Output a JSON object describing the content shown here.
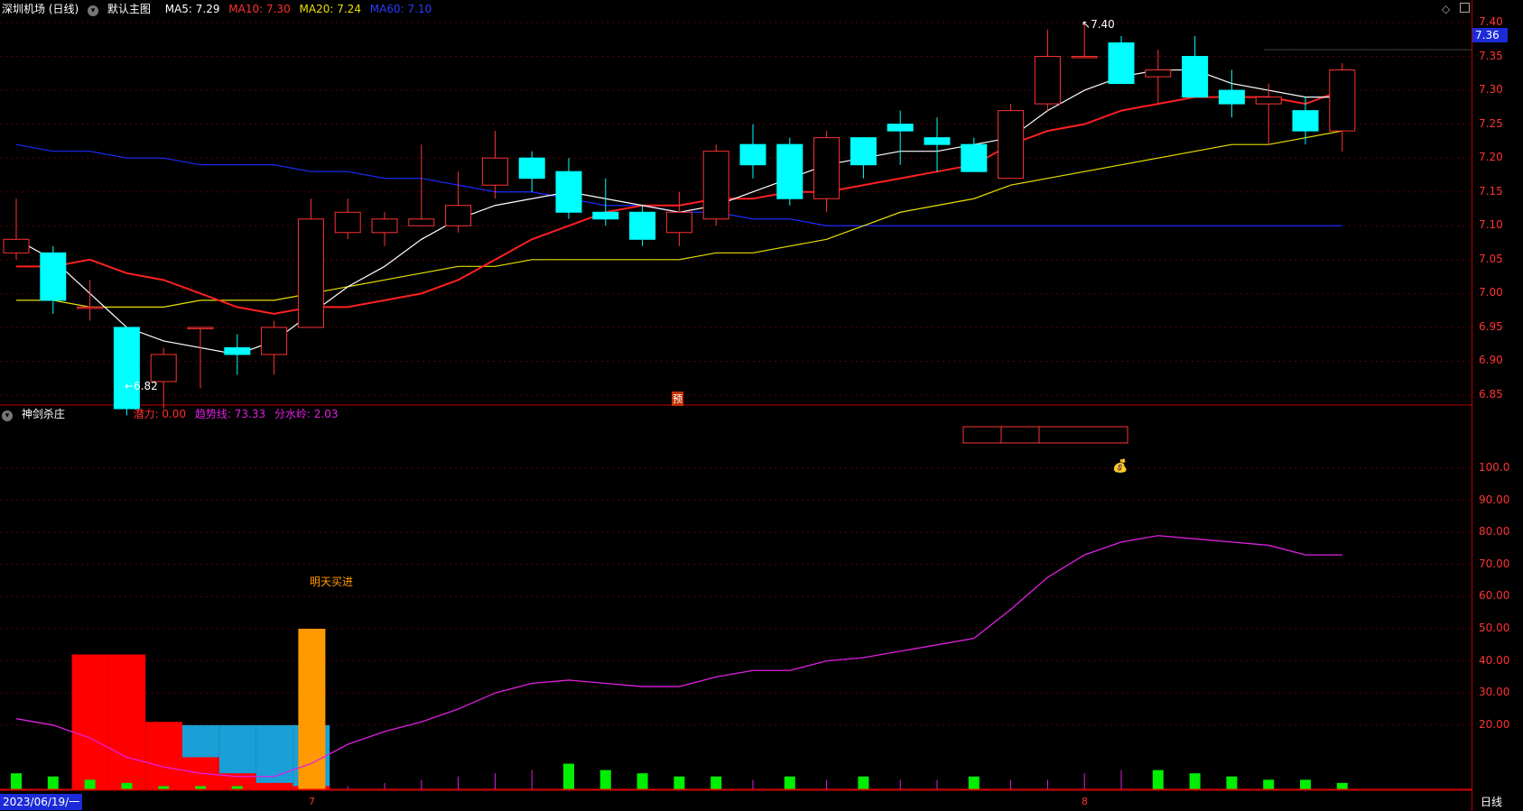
{
  "main_panel": {
    "stock_name": "深圳机场 (日线)",
    "template_label": "默认主图",
    "ma5": "MA5: 7.29",
    "ma10": "MA10: 7.30",
    "ma20": "MA20: 7.24",
    "ma60": "MA60: 7.10",
    "current_price": "7.36",
    "high_marker": "7.40",
    "low_marker": "6.82",
    "pre_marker": "预",
    "y_ticks": [
      "7.40",
      "7.35",
      "7.30",
      "7.25",
      "7.20",
      "7.15",
      "7.10",
      "7.05",
      "7.00",
      "6.95",
      "6.90",
      "6.85"
    ]
  },
  "sub_panel": {
    "indicator_name": "神剑杀庄",
    "latent_power": "潜力: 0.00",
    "trend_line": "趋势线: 73.33",
    "watershed": "分水岭: 2.03",
    "buy_signal": "明天买进",
    "y_ticks": [
      "100.0",
      "90.00",
      "80.00",
      "70.00",
      "60.00",
      "50.00",
      "40.00",
      "30.00",
      "20.00"
    ]
  },
  "bottom_bar": {
    "date_label": "2023/06/19/一",
    "month_7": "7",
    "month_8": "8",
    "period_label": "日线"
  },
  "colors": {
    "up": "#ff3333",
    "down": "#00ffff",
    "ma5": "#ffffff",
    "ma10": "#ff2020",
    "ma20": "#e8e000",
    "ma60": "#1a2cff",
    "trend": "#e020e0",
    "accent_orange": "#ff9900"
  },
  "chart_data": {
    "type": "candlestick",
    "candles": [
      {
        "o": 7.06,
        "h": 7.14,
        "l": 7.05,
        "c": 7.08
      },
      {
        "o": 7.06,
        "h": 7.07,
        "l": 6.97,
        "c": 6.99
      },
      {
        "o": 6.98,
        "h": 7.02,
        "l": 6.96,
        "c": 6.98
      },
      {
        "o": 6.95,
        "h": 6.95,
        "l": 6.82,
        "c": 6.83
      },
      {
        "o": 6.87,
        "h": 6.92,
        "l": 6.83,
        "c": 6.91
      },
      {
        "o": 6.95,
        "h": 6.95,
        "l": 6.86,
        "c": 6.95
      },
      {
        "o": 6.92,
        "h": 6.94,
        "l": 6.88,
        "c": 6.91
      },
      {
        "o": 6.91,
        "h": 6.96,
        "l": 6.88,
        "c": 6.95
      },
      {
        "o": 6.95,
        "h": 7.14,
        "l": 6.95,
        "c": 7.11
      },
      {
        "o": 7.09,
        "h": 7.14,
        "l": 7.08,
        "c": 7.12
      },
      {
        "o": 7.09,
        "h": 7.12,
        "l": 7.07,
        "c": 7.11
      },
      {
        "o": 7.1,
        "h": 7.22,
        "l": 7.1,
        "c": 7.11
      },
      {
        "o": 7.1,
        "h": 7.18,
        "l": 7.09,
        "c": 7.13
      },
      {
        "o": 7.16,
        "h": 7.24,
        "l": 7.14,
        "c": 7.2
      },
      {
        "o": 7.2,
        "h": 7.21,
        "l": 7.15,
        "c": 7.17
      },
      {
        "o": 7.18,
        "h": 7.2,
        "l": 7.11,
        "c": 7.12
      },
      {
        "o": 7.12,
        "h": 7.17,
        "l": 7.1,
        "c": 7.11
      },
      {
        "o": 7.12,
        "h": 7.13,
        "l": 7.07,
        "c": 7.08
      },
      {
        "o": 7.09,
        "h": 7.15,
        "l": 7.07,
        "c": 7.12
      },
      {
        "o": 7.11,
        "h": 7.22,
        "l": 7.1,
        "c": 7.21
      },
      {
        "o": 7.22,
        "h": 7.25,
        "l": 7.17,
        "c": 7.19
      },
      {
        "o": 7.22,
        "h": 7.23,
        "l": 7.13,
        "c": 7.14
      },
      {
        "o": 7.14,
        "h": 7.24,
        "l": 7.12,
        "c": 7.23
      },
      {
        "o": 7.23,
        "h": 7.23,
        "l": 7.17,
        "c": 7.19
      },
      {
        "o": 7.25,
        "h": 7.27,
        "l": 7.19,
        "c": 7.24
      },
      {
        "o": 7.23,
        "h": 7.26,
        "l": 7.18,
        "c": 7.22
      },
      {
        "o": 7.22,
        "h": 7.23,
        "l": 7.18,
        "c": 7.18
      },
      {
        "o": 7.17,
        "h": 7.28,
        "l": 7.17,
        "c": 7.27
      },
      {
        "o": 7.28,
        "h": 7.39,
        "l": 7.27,
        "c": 7.35
      },
      {
        "o": 7.35,
        "h": 7.4,
        "l": 7.35,
        "c": 7.35
      },
      {
        "o": 7.37,
        "h": 7.38,
        "l": 7.31,
        "c": 7.31
      },
      {
        "o": 7.32,
        "h": 7.36,
        "l": 7.28,
        "c": 7.33
      },
      {
        "o": 7.35,
        "h": 7.38,
        "l": 7.29,
        "c": 7.29
      },
      {
        "o": 7.3,
        "h": 7.33,
        "l": 7.26,
        "c": 7.28
      },
      {
        "o": 7.28,
        "h": 7.31,
        "l": 7.22,
        "c": 7.29
      },
      {
        "o": 7.27,
        "h": 7.29,
        "l": 7.22,
        "c": 7.24
      },
      {
        "o": 7.24,
        "h": 7.34,
        "l": 7.21,
        "c": 7.33
      }
    ],
    "ma5": [
      7.08,
      7.05,
      7.0,
      6.95,
      6.93,
      6.92,
      6.91,
      6.93,
      6.97,
      7.01,
      7.04,
      7.08,
      7.11,
      7.13,
      7.14,
      7.15,
      7.14,
      7.13,
      7.12,
      7.13,
      7.15,
      7.17,
      7.19,
      7.2,
      7.21,
      7.21,
      7.22,
      7.23,
      7.27,
      7.3,
      7.32,
      7.33,
      7.33,
      7.31,
      7.3,
      7.29,
      7.29
    ],
    "ma10": [
      7.04,
      7.04,
      7.05,
      7.03,
      7.02,
      7.0,
      6.98,
      6.97,
      6.98,
      6.98,
      6.99,
      7.0,
      7.02,
      7.05,
      7.08,
      7.1,
      7.12,
      7.13,
      7.13,
      7.14,
      7.14,
      7.15,
      7.15,
      7.16,
      7.17,
      7.18,
      7.19,
      7.22,
      7.24,
      7.25,
      7.27,
      7.28,
      7.29,
      7.29,
      7.29,
      7.28,
      7.3
    ],
    "ma20": [
      6.99,
      6.99,
      6.98,
      6.98,
      6.98,
      6.99,
      6.99,
      6.99,
      7.0,
      7.01,
      7.02,
      7.03,
      7.04,
      7.04,
      7.05,
      7.05,
      7.05,
      7.05,
      7.05,
      7.06,
      7.06,
      7.07,
      7.08,
      7.1,
      7.12,
      7.13,
      7.14,
      7.16,
      7.17,
      7.18,
      7.19,
      7.2,
      7.21,
      7.22,
      7.22,
      7.23,
      7.24
    ],
    "ma60": [
      7.22,
      7.21,
      7.21,
      7.2,
      7.2,
      7.19,
      7.19,
      7.19,
      7.18,
      7.18,
      7.17,
      7.17,
      7.16,
      7.15,
      7.15,
      7.14,
      7.13,
      7.13,
      7.12,
      7.12,
      7.11,
      7.11,
      7.1,
      7.1,
      7.1,
      7.1,
      7.1,
      7.1,
      7.1,
      7.1,
      7.1,
      7.1,
      7.1,
      7.1,
      7.1,
      7.1,
      7.1
    ],
    "trend": [
      22,
      20,
      16,
      10,
      7,
      5,
      4,
      4,
      8,
      14,
      18,
      21,
      25,
      30,
      33,
      34,
      33,
      32,
      32,
      35,
      37,
      37,
      40,
      41,
      43,
      45,
      47,
      56,
      66,
      73,
      77,
      79,
      78,
      77,
      76,
      73,
      73
    ],
    "red_bars": [
      0,
      0,
      42,
      42,
      21,
      10,
      5,
      2,
      1,
      0,
      0,
      0,
      0,
      0,
      0,
      0,
      0,
      0,
      0,
      0,
      0,
      0,
      0,
      0,
      0,
      0,
      0,
      0,
      0,
      0,
      0,
      0,
      0,
      0,
      0,
      0,
      0
    ],
    "blue_block": [
      0,
      0,
      0,
      0,
      0,
      20,
      20,
      20,
      20,
      0,
      0,
      0,
      0,
      0,
      0,
      0,
      0,
      0,
      0,
      0,
      0,
      0,
      0,
      0,
      0,
      0,
      0,
      0,
      0,
      0,
      0,
      0,
      0,
      0,
      0,
      0,
      0
    ],
    "orange_bar": [
      0,
      0,
      0,
      0,
      0,
      0,
      0,
      0,
      50,
      0,
      0,
      0,
      0,
      0,
      0,
      0,
      0,
      0,
      0,
      0,
      0,
      0,
      0,
      0,
      0,
      0,
      0,
      0,
      0,
      0,
      0,
      0,
      0,
      0,
      0,
      0,
      0
    ],
    "green_bars": [
      5,
      4,
      3,
      2,
      1,
      1,
      1,
      0,
      0,
      0,
      0,
      0,
      0,
      0,
      0,
      8,
      6,
      5,
      4,
      4,
      0,
      4,
      0,
      4,
      0,
      0,
      4,
      0,
      0,
      0,
      0,
      6,
      5,
      4,
      3,
      3,
      2
    ],
    "magenta_ticks": [
      0,
      0,
      0,
      0,
      0,
      0,
      0,
      0,
      0,
      1,
      2,
      3,
      4,
      5,
      6,
      0,
      0,
      0,
      0,
      0,
      3,
      0,
      3,
      0,
      3,
      3,
      0,
      3,
      3,
      5,
      6,
      0,
      0,
      0,
      0,
      0,
      0
    ]
  }
}
